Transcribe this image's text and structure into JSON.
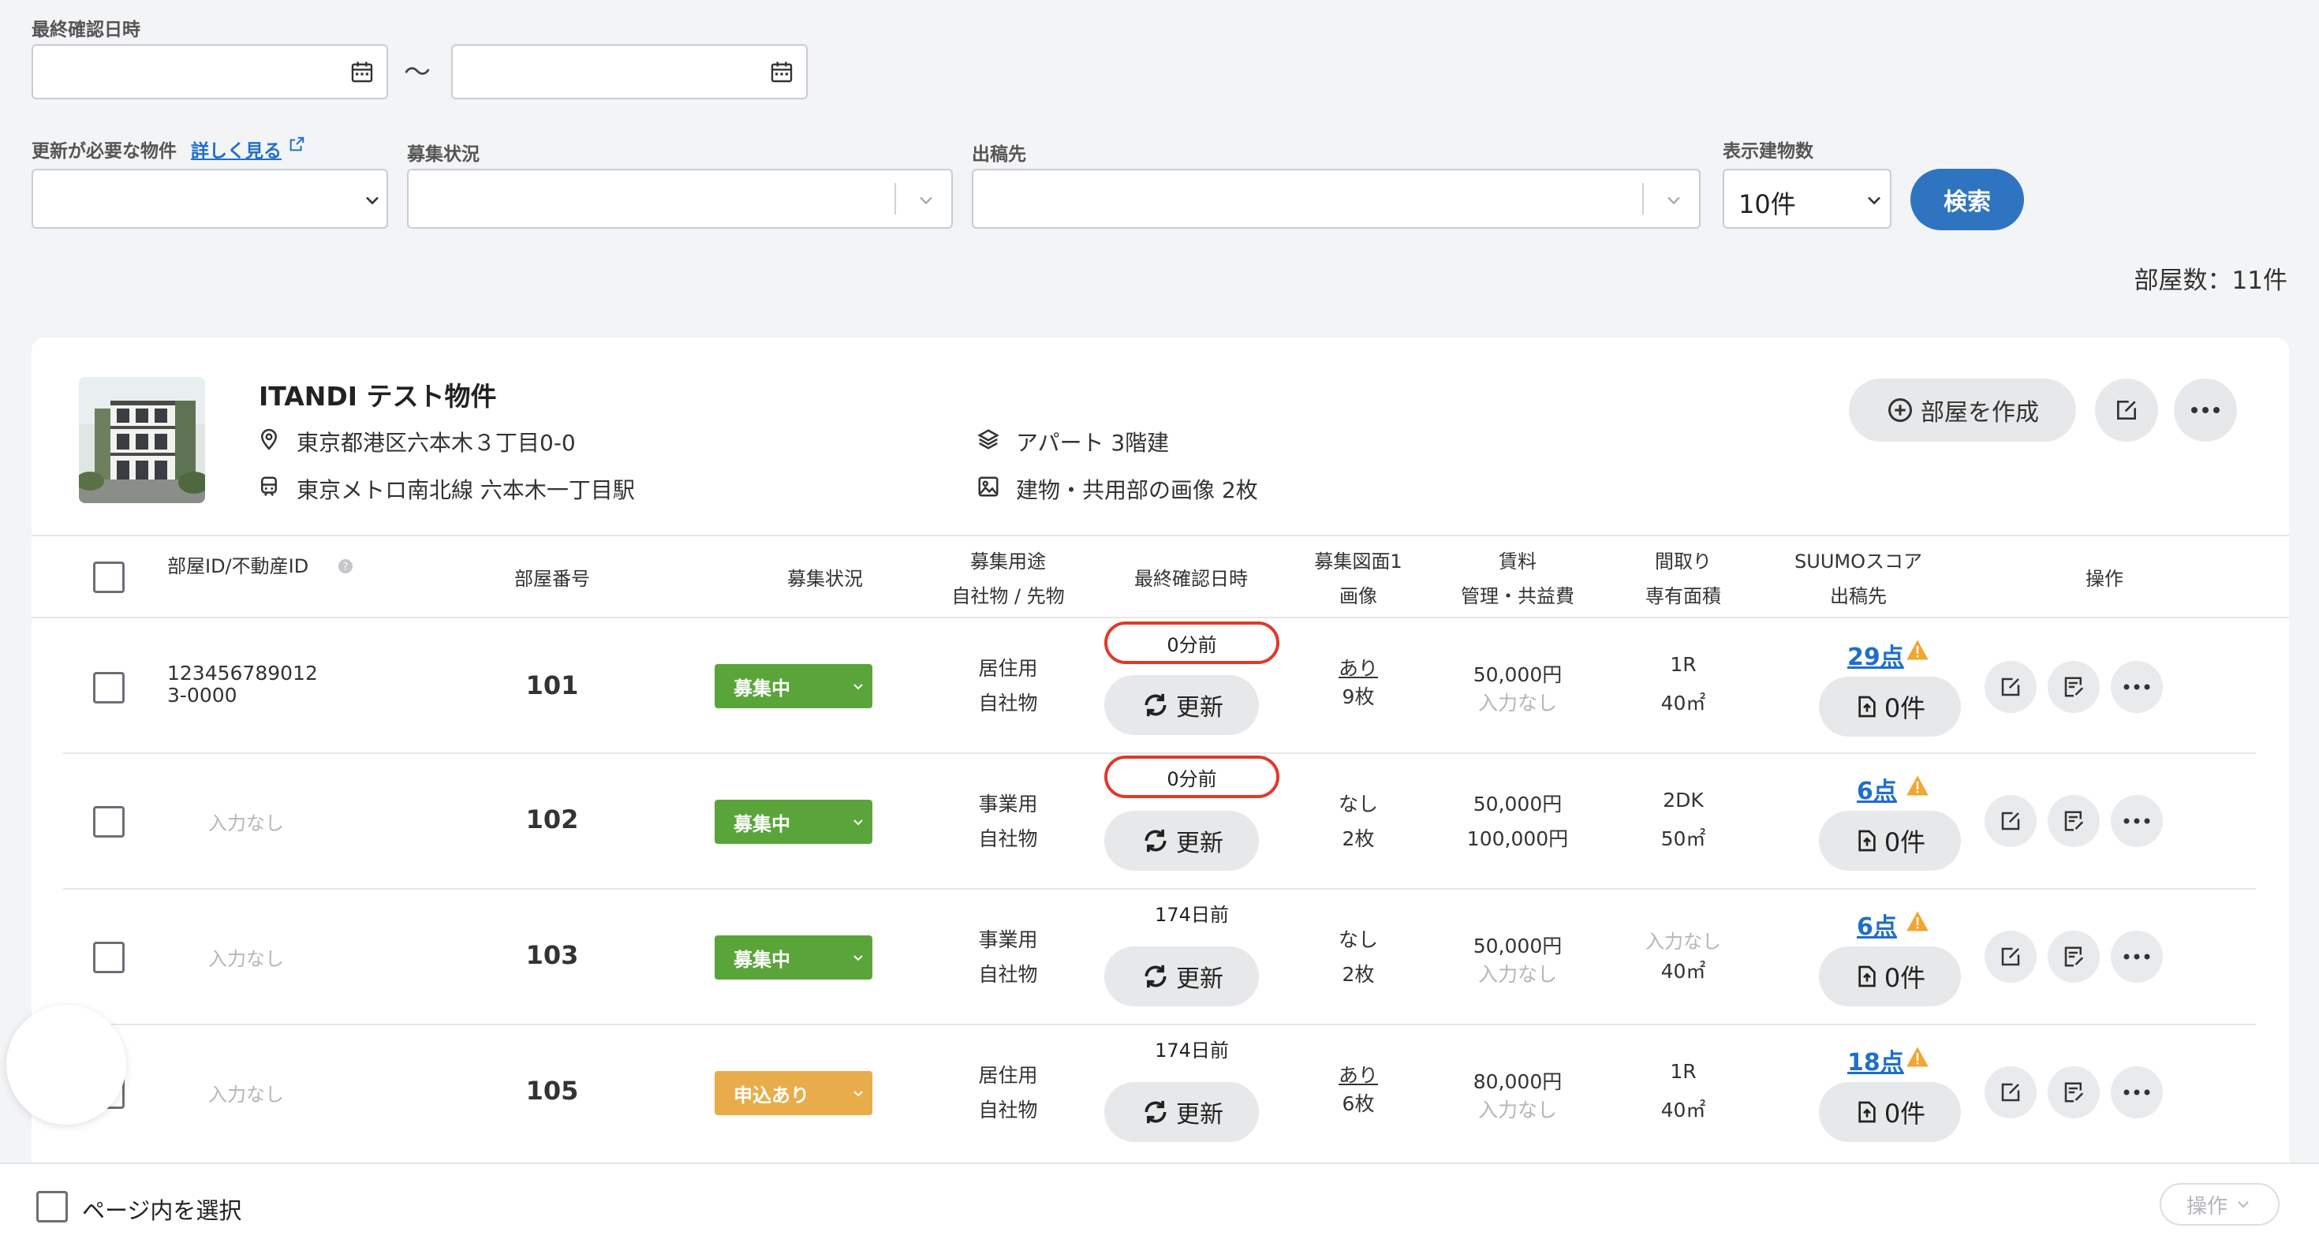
{
  "filters": {
    "last_confirmed": {
      "label": "最終確認日時",
      "separator": "〜",
      "from": "",
      "to": ""
    },
    "needs_update": {
      "label": "更新が必要な物件",
      "detail_link": "詳しく見る",
      "value": ""
    },
    "recruit_status": {
      "label": "募集状況",
      "value": ""
    },
    "destination": {
      "label": "出稿先",
      "value": ""
    },
    "display_count": {
      "label": "表示建物数",
      "value": "10件"
    },
    "search_button": "検索"
  },
  "room_count": "部屋数：11件",
  "property": {
    "name": "ITANDI テスト物件",
    "address": "東京都港区六本木３丁目0-0",
    "station": "東京メトロ南北線 六本木一丁目駅",
    "building_type": "アパート 3階建",
    "images": "建物・共用部の画像 2枚",
    "create_room_button": "部屋を作成"
  },
  "table": {
    "headers": {
      "room_id": "部屋ID/不動産ID",
      "room_number": "部屋番号",
      "status": "募集状況",
      "usage_1": "募集用途",
      "usage_2": "自社物 / 先物",
      "last_confirmed": "最終確認日時",
      "floorplan_1": "募集図面1",
      "floorplan_2": "画像",
      "rent_1": "賃料",
      "rent_2": "管理・共益費",
      "layout_1": "間取り",
      "layout_2": "専有面積",
      "suumo_1": "SUUMOスコア",
      "suumo_2": "出稿先",
      "actions": "操作"
    },
    "update_label": "更新",
    "rows": [
      {
        "room_id": "123456789012\n3-0000",
        "room_number": "101",
        "status": "募集中",
        "usage": "居住用",
        "ownership": "自社物",
        "last_confirmed": "0分前",
        "highlighted": true,
        "floorplan": "あり",
        "images": "9枚",
        "rent": "50,000円",
        "fee": "入力なし",
        "layout": "1R",
        "area": "40㎡",
        "score": "29点",
        "published": "0件"
      },
      {
        "room_id": "入力なし",
        "room_number": "102",
        "status": "募集中",
        "usage": "事業用",
        "ownership": "自社物",
        "last_confirmed": "0分前",
        "highlighted": true,
        "floorplan": "なし",
        "images": "2枚",
        "rent": "50,000円",
        "fee": "100,000円",
        "layout": "2DK",
        "area": "50㎡",
        "score": "6点",
        "published": "0件"
      },
      {
        "room_id": "入力なし",
        "room_number": "103",
        "status": "募集中",
        "usage": "事業用",
        "ownership": "自社物",
        "last_confirmed": "174日前",
        "highlighted": false,
        "floorplan": "なし",
        "images": "2枚",
        "rent": "50,000円",
        "fee": "入力なし",
        "layout": "入力なし",
        "area": "40㎡",
        "score": "6点",
        "published": "0件"
      },
      {
        "room_id": "入力なし",
        "room_number": "105",
        "status": "申込あり",
        "usage": "居住用",
        "ownership": "自社物",
        "last_confirmed": "174日前",
        "highlighted": false,
        "floorplan": "あり",
        "images": "6枚",
        "rent": "80,000円",
        "fee": "入力なし",
        "layout": "1R",
        "area": "40㎡",
        "score": "18点",
        "published": "0件"
      }
    ]
  },
  "footer": {
    "select_page": "ページ内を選択",
    "actions": "操作"
  },
  "colors": {
    "accent": "#2f74c0",
    "status_open": "#5aa53a",
    "status_applied": "#e8ad4a",
    "highlight": "#e0392b",
    "warning": "#f0a630"
  }
}
